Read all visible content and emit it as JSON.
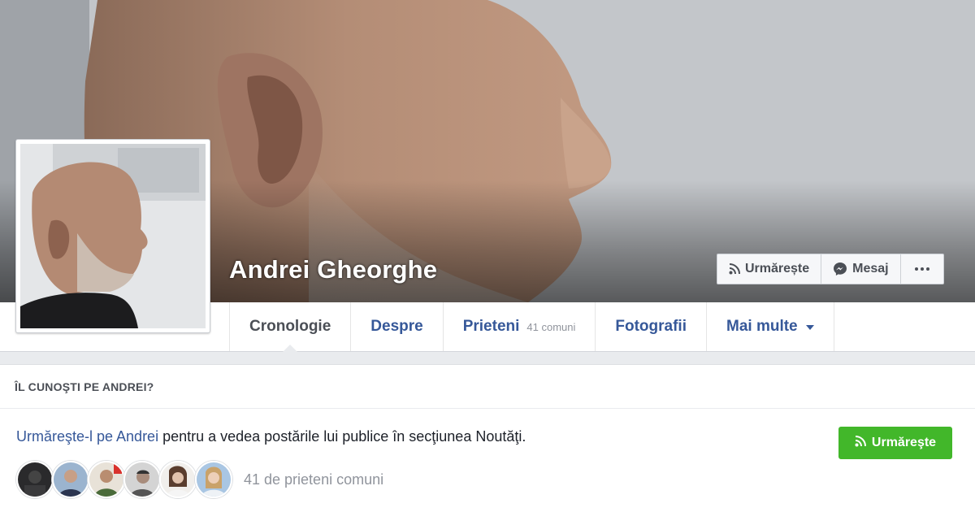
{
  "profile": {
    "name": "Andrei Gheorghe"
  },
  "cover_actions": [
    {
      "label": "Urmărește",
      "icon": "rss-icon"
    },
    {
      "label": "Mesaj",
      "icon": "messenger-icon"
    },
    {
      "label": "",
      "icon": "more-dots-icon"
    }
  ],
  "tabs": [
    {
      "label": "Cronologie",
      "sub": "",
      "active": true
    },
    {
      "label": "Despre",
      "sub": ""
    },
    {
      "label": "Prieteni",
      "sub": "41 comuni"
    },
    {
      "label": "Fotografii",
      "sub": ""
    },
    {
      "label": "Mai multe",
      "sub": "",
      "dropdown": true
    }
  ],
  "know_card": {
    "header": "ÎL CUNOŞTI PE ANDREI?",
    "link_text": "Urmăreşte-l pe Andrei",
    "rest_text": " pentru a vedea postările lui publice în secţiunea Noutăţi.",
    "follow_button": "Urmăreşte",
    "mutual_friends": "41 de prieteni comuni"
  },
  "colors": {
    "link": "#365899",
    "follow_green": "#42b72a",
    "muted": "#90949c"
  }
}
